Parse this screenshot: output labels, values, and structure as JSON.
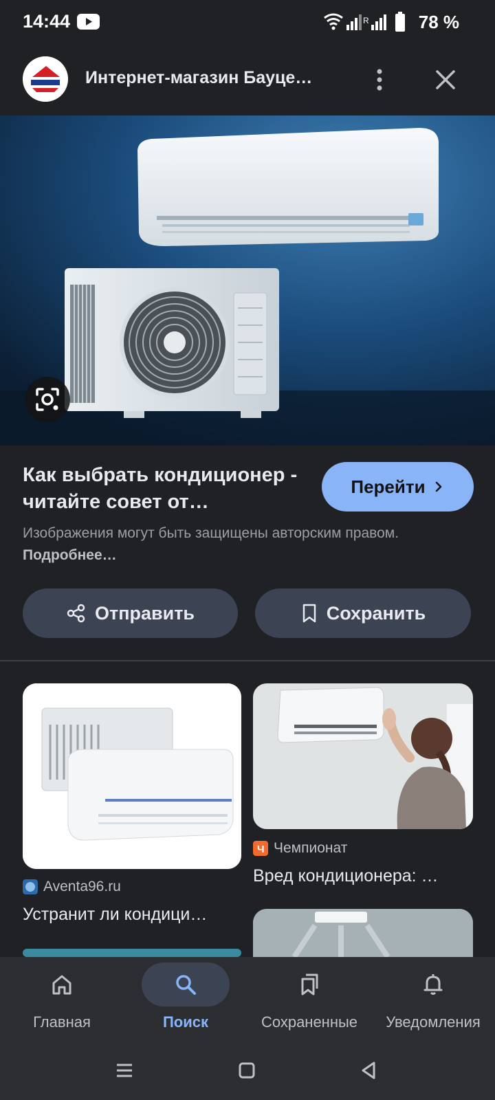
{
  "status_bar": {
    "time": "14:44",
    "battery": "78 %",
    "icons": [
      "youtube-icon",
      "wifi-icon",
      "signal-icon",
      "roaming-signal-icon",
      "battery-icon"
    ]
  },
  "header": {
    "title": "Интернет-магазин Бауце…",
    "icons": [
      "site-logo",
      "more-vert-icon",
      "close-icon"
    ]
  },
  "result": {
    "title": "Как выбрать кондиционер - читайте совет от…",
    "goto_label": "Перейти",
    "copyright_text": "Изображения могут быть защищены авторским правом.",
    "more_link": "Подробнее…"
  },
  "actions": {
    "share_label": "Отправить",
    "save_label": "Сохранить"
  },
  "related": [
    {
      "source": "Aventa96.ru",
      "title": "Устранит ли кондици…"
    },
    {
      "source": "Чемпионат",
      "title": "Вред кондиционера: …"
    }
  ],
  "bottom_nav": [
    {
      "label": "Главная",
      "icon": "home-icon",
      "active": false
    },
    {
      "label": "Поиск",
      "icon": "search-icon",
      "active": true
    },
    {
      "label": "Сохраненные",
      "icon": "collections-icon",
      "active": false
    },
    {
      "label": "Уведомления",
      "icon": "bell-icon",
      "active": false
    }
  ],
  "colors": {
    "background": "#1f2125",
    "accent": "#8ab4f8",
    "button_bg": "#3c4352",
    "nav_bg": "#2b2d31"
  }
}
